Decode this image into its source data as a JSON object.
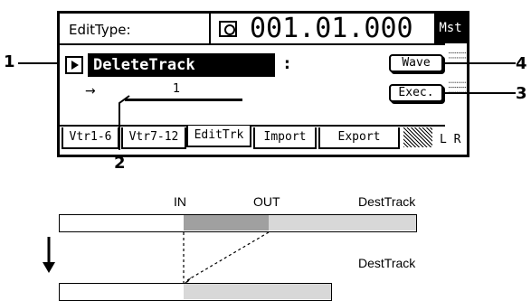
{
  "lcd": {
    "edit_type_label": "EditType:",
    "counter": "001.01.000",
    "mst": "Mst",
    "operation": "DeleteTrack",
    "colon": ":",
    "wave_button": "Wave",
    "exec_button": "Exec.",
    "arrow": "→",
    "track_number": "1",
    "tabs": [
      {
        "label": "Vtr1-6"
      },
      {
        "label": "Vtr7-12"
      },
      {
        "label": "EditTrk"
      },
      {
        "label": "Import"
      },
      {
        "label": "Export"
      }
    ],
    "lr": "L R"
  },
  "callouts": {
    "one": "1",
    "two": "2",
    "three": "3",
    "four": "4"
  },
  "diagram": {
    "in_label": "IN",
    "out_label": "OUT",
    "dest_track_top": "DestTrack",
    "dest_track_bottom": "DestTrack"
  },
  "colors": {
    "region_selected": "#a0a0a0",
    "region_remaining": "#d8d8d8",
    "track_empty": "#ffffff"
  }
}
